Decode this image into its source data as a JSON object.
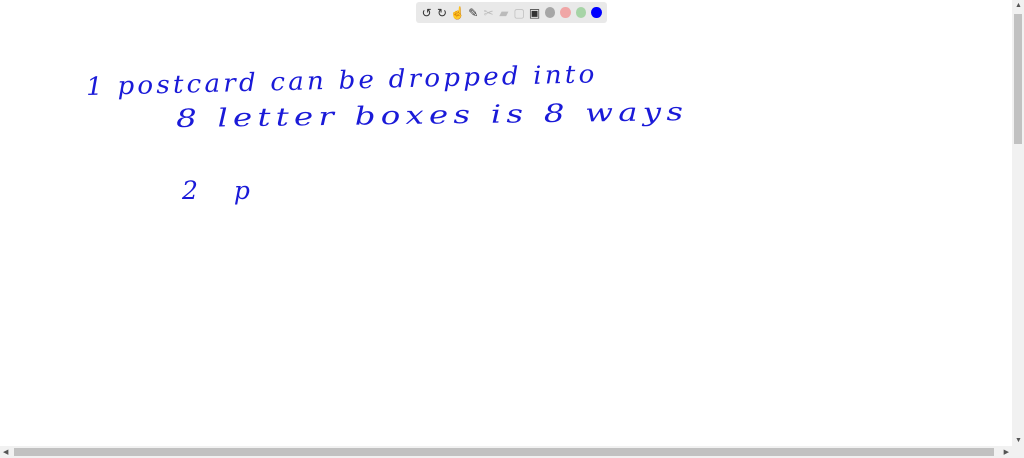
{
  "toolbar": {
    "tools": [
      "undo-icon",
      "redo-icon",
      "select-icon",
      "pencil-icon",
      "scissors-icon",
      "highlighter-icon",
      "textbox-icon",
      "image-icon"
    ],
    "colors": [
      "#a6a6a6",
      "#f0a6a6",
      "#a6d4a6",
      "#0000ff"
    ],
    "selected_color": "#0000ff"
  },
  "canvas": {
    "ink_color": "#1a1ad8",
    "lines": [
      "1 postcard can be dropped into",
      "8 letter boxes is 8 ways",
      "2 p"
    ]
  }
}
